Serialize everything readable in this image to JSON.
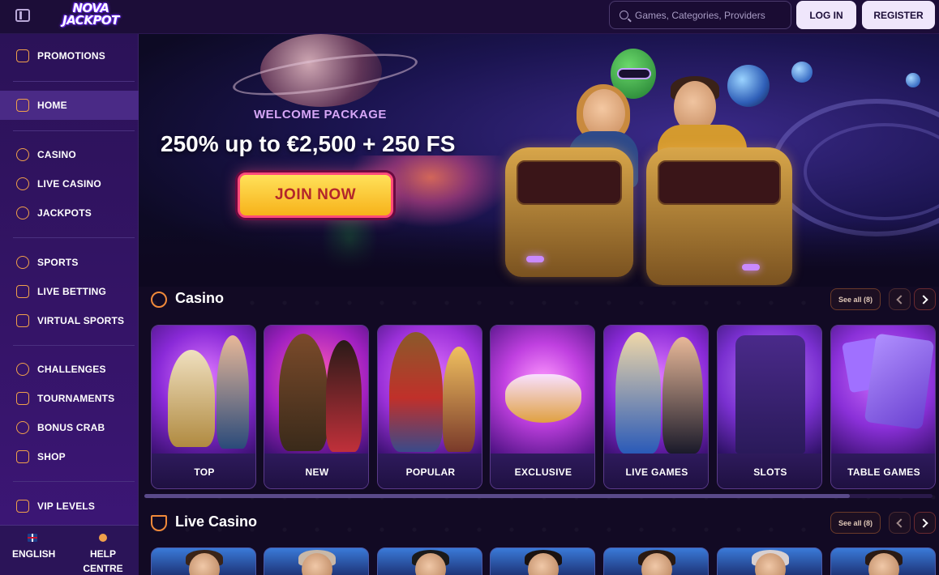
{
  "header": {
    "logo_line1": "NOVA",
    "logo_line2": "JACKPOT",
    "search_placeholder": "Games, Categories, Providers",
    "login_label": "LOG IN",
    "register_label": "REGISTER"
  },
  "sidebar": {
    "items": [
      {
        "label": "PROMOTIONS",
        "icon": "gift-icon"
      },
      {
        "label": "HOME",
        "icon": "home-icon",
        "active": true
      },
      {
        "label": "CASINO",
        "icon": "chip-icon"
      },
      {
        "label": "LIVE CASINO",
        "icon": "spade-icon"
      },
      {
        "label": "JACKPOTS",
        "icon": "seven-icon"
      },
      {
        "label": "SPORTS",
        "icon": "ball-icon"
      },
      {
        "label": "LIVE BETTING",
        "icon": "play-icon"
      },
      {
        "label": "VIRTUAL SPORTS",
        "icon": "gamepad-icon"
      },
      {
        "label": "CHALLENGES",
        "icon": "medal-icon"
      },
      {
        "label": "TOURNAMENTS",
        "icon": "trophy-icon"
      },
      {
        "label": "BONUS CRAB",
        "icon": "claw-icon"
      },
      {
        "label": "SHOP",
        "icon": "shop-icon"
      },
      {
        "label": "VIP LEVELS",
        "icon": "diamond-icon"
      }
    ],
    "language_label": "ENGLISH",
    "help_label": "HELP CENTRE"
  },
  "hero": {
    "kicker": "WELCOME PACKAGE",
    "title": "250% up to €2,500 + 250 FS",
    "cta_label": "JOIN NOW"
  },
  "casino_section": {
    "title": "Casino",
    "see_all_label": "See all (8)",
    "cards": [
      {
        "label": "TOP"
      },
      {
        "label": "NEW"
      },
      {
        "label": "POPULAR"
      },
      {
        "label": "EXCLUSIVE"
      },
      {
        "label": "LIVE GAMES"
      },
      {
        "label": "SLOTS"
      },
      {
        "label": "TABLE GAMES"
      }
    ]
  },
  "live_casino_section": {
    "title": "Live Casino",
    "see_all_label": "See all (8)"
  },
  "colors": {
    "accent_orange": "#f0893a",
    "sidebar_bg": "#2b1258",
    "button_light": "#efe6fb",
    "cta_yellow": "#ffe15a",
    "cta_text": "#b3262b"
  }
}
